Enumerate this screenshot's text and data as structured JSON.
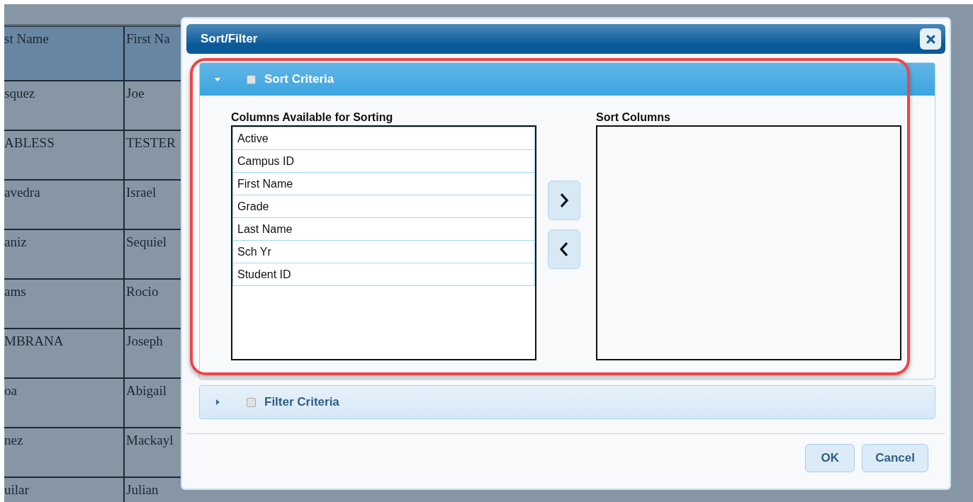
{
  "background_table": {
    "columns": [
      "st Name",
      "First Na"
    ],
    "rows": [
      [
        "squez",
        "Joe"
      ],
      [
        "ABLESS",
        "TESTER"
      ],
      [
        "avedra",
        "Israel"
      ],
      [
        "aniz",
        "Sequiel"
      ],
      [
        "ams",
        "Rocio"
      ],
      [
        "MBRANA",
        "Joseph"
      ],
      [
        "oa",
        "Abigail"
      ],
      [
        "nez",
        "Mackayl"
      ],
      [
        "uilar",
        "Julian"
      ]
    ]
  },
  "dialog": {
    "title": "Sort/Filter",
    "sections": [
      {
        "kind": "sort",
        "title": "Sort Criteria",
        "expanded": true,
        "checked": false,
        "available_label": "Columns Available for Sorting",
        "available": [
          "Active",
          "Campus ID",
          "First Name",
          "Grade",
          "Last Name",
          "Sch Yr",
          "Student ID"
        ],
        "selected_label": "Sort Columns"
      },
      {
        "kind": "filter",
        "title": "Filter Criteria",
        "expanded": false,
        "checked": false
      }
    ],
    "buttons": [
      "OK",
      "Cancel"
    ]
  }
}
